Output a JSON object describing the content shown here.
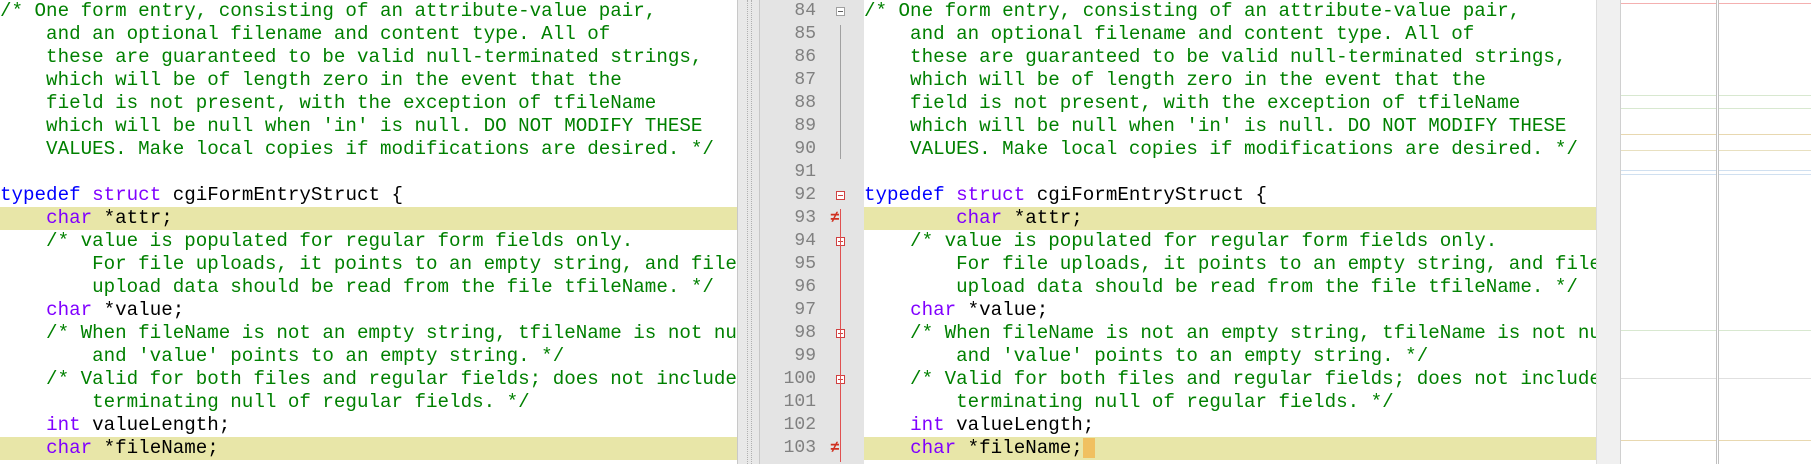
{
  "left": {
    "lines": [
      [
        {
          "t": "/* One form entry, consisting of an attribute-value pair,",
          "c": "cm"
        }
      ],
      [
        {
          "t": "    and an optional filename and content type. All of",
          "c": "cm"
        }
      ],
      [
        {
          "t": "    these are guaranteed to be valid null-terminated strings,",
          "c": "cm"
        }
      ],
      [
        {
          "t": "    which will be of length zero in the event that the",
          "c": "cm"
        }
      ],
      [
        {
          "t": "    field is not present, with the exception of tfileName",
          "c": "cm"
        }
      ],
      [
        {
          "t": "    which will be null when 'in' is null. DO NOT MODIFY THESE",
          "c": "cm"
        }
      ],
      [
        {
          "t": "    VALUES. Make local copies if modifications are desired. */",
          "c": "cm"
        }
      ],
      [],
      [
        {
          "t": "typedef",
          "c": "kw"
        },
        {
          "t": " ",
          "c": "plain"
        },
        {
          "t": "struct",
          "c": "type"
        },
        {
          "t": " cgiFormEntryStruct {",
          "c": "plain"
        }
      ],
      [
        {
          "t": "    ",
          "c": "plain"
        },
        {
          "t": "char",
          "c": "type"
        },
        {
          "t": " *attr;",
          "c": "plain"
        }
      ],
      [
        {
          "t": "    /* value is populated for regular form fields only.",
          "c": "cm"
        }
      ],
      [
        {
          "t": "        For file uploads, it points to an empty string, and file",
          "c": "cm"
        }
      ],
      [
        {
          "t": "        upload data should be read from the file tfileName. */",
          "c": "cm"
        }
      ],
      [
        {
          "t": "    ",
          "c": "plain"
        },
        {
          "t": "char",
          "c": "type"
        },
        {
          "t": " *value;",
          "c": "plain"
        }
      ],
      [
        {
          "t": "    /* When fileName is not an empty string, tfileName is not null,",
          "c": "cm"
        }
      ],
      [
        {
          "t": "        and 'value' points to an empty string. */",
          "c": "cm"
        }
      ],
      [
        {
          "t": "    /* Valid for both files and regular fields; does not include",
          "c": "cm"
        }
      ],
      [
        {
          "t": "        terminating null of regular fields. */",
          "c": "cm"
        }
      ],
      [
        {
          "t": "    ",
          "c": "plain"
        },
        {
          "t": "int",
          "c": "type"
        },
        {
          "t": " valueLength;",
          "c": "plain"
        }
      ],
      [
        {
          "t": "    ",
          "c": "plain"
        },
        {
          "t": "char",
          "c": "type"
        },
        {
          "t": " *fileName;",
          "c": "plain"
        }
      ]
    ],
    "highlight": [
      9,
      19
    ]
  },
  "right": {
    "line_numbers": [
      "84",
      "85",
      "86",
      "87",
      "88",
      "89",
      "90",
      "91",
      "92",
      "93",
      "94",
      "95",
      "96",
      "97",
      "98",
      "99",
      "100",
      "101",
      "102",
      "103"
    ],
    "lines": [
      [
        {
          "t": "/* One form entry, consisting of an attribute-value pair,",
          "c": "cm"
        }
      ],
      [
        {
          "t": "    and an optional filename and content type. All of",
          "c": "cm"
        }
      ],
      [
        {
          "t": "    these are guaranteed to be valid null-terminated strings,",
          "c": "cm"
        }
      ],
      [
        {
          "t": "    which will be of length zero in the event that the",
          "c": "cm"
        }
      ],
      [
        {
          "t": "    field is not present, with the exception of tfileName",
          "c": "cm"
        }
      ],
      [
        {
          "t": "    which will be null when 'in' is null. DO NOT MODIFY THESE",
          "c": "cm"
        }
      ],
      [
        {
          "t": "    VALUES. Make local copies if modifications are desired. */",
          "c": "cm"
        }
      ],
      [],
      [
        {
          "t": "typedef",
          "c": "kw"
        },
        {
          "t": " ",
          "c": "plain"
        },
        {
          "t": "struct",
          "c": "type"
        },
        {
          "t": " cgiFormEntryStruct {",
          "c": "plain"
        }
      ],
      [
        {
          "t": "        ",
          "c": "plain"
        },
        {
          "t": "char",
          "c": "type"
        },
        {
          "t": " *attr;",
          "c": "plain"
        }
      ],
      [
        {
          "t": "    /* value is populated for regular form fields only.",
          "c": "cm"
        }
      ],
      [
        {
          "t": "        For file uploads, it points to an empty string, and file",
          "c": "cm"
        }
      ],
      [
        {
          "t": "        upload data should be read from the file tfileName. */",
          "c": "cm"
        }
      ],
      [
        {
          "t": "    ",
          "c": "plain"
        },
        {
          "t": "char",
          "c": "type"
        },
        {
          "t": " *value;",
          "c": "plain"
        }
      ],
      [
        {
          "t": "    /* When fileName is not an empty string, tfileName is not null,",
          "c": "cm"
        }
      ],
      [
        {
          "t": "        and 'value' points to an empty string. */",
          "c": "cm"
        }
      ],
      [
        {
          "t": "    /* Valid for both files and regular fields; does not include",
          "c": "cm"
        }
      ],
      [
        {
          "t": "        terminating null of regular fields. */",
          "c": "cm"
        }
      ],
      [
        {
          "t": "    ",
          "c": "plain"
        },
        {
          "t": "int",
          "c": "type"
        },
        {
          "t": " valueLength;",
          "c": "plain"
        }
      ],
      [
        {
          "t": "    ",
          "c": "plain"
        },
        {
          "t": "char",
          "c": "type"
        },
        {
          "t": " *fileName;",
          "c": "plain"
        }
      ]
    ],
    "highlight": [
      9,
      19
    ],
    "fold_markers": [
      0,
      8,
      10,
      14,
      16
    ],
    "diff_markers": [
      9,
      19
    ]
  },
  "colors": {
    "comment": "#008000",
    "keyword": "#0000ff",
    "type": "#8000ff",
    "highlight": "#e8e6a8",
    "diff_mark": "#d03020"
  }
}
